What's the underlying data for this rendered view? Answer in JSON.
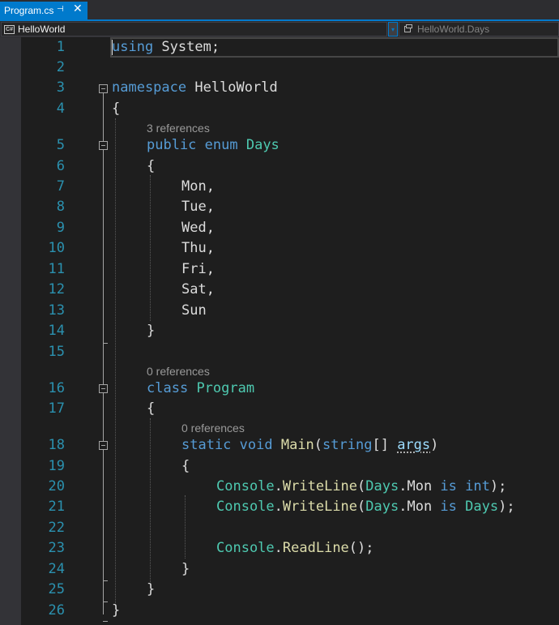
{
  "tab": {
    "title": "Program.cs",
    "pin": "⊣",
    "close": "✕"
  },
  "nav": {
    "project": "HelloWorld",
    "project_icon": "C#",
    "dropdown_glyph": "▾",
    "member": "HelloWorld.Days",
    "member_icon": "member-icon"
  },
  "editor": {
    "line_numbers": [
      "1",
      "2",
      "3",
      "4",
      "5",
      "6",
      "7",
      "8",
      "9",
      "10",
      "11",
      "12",
      "13",
      "14",
      "15",
      "16",
      "17",
      "18",
      "19",
      "20",
      "21",
      "22",
      "23",
      "24",
      "25",
      "26"
    ],
    "lens": [
      "3 references",
      "0 references",
      "0 references"
    ],
    "code": {
      "l1_kw": "using",
      "l1_rest": " System;",
      "l3_kw": "namespace",
      "l3_rest": " HelloWorld",
      "l4": "{",
      "l5_kw": "public enum",
      "l5_ty": "Days",
      "l6": "{",
      "l7": "Mon,",
      "l8": "Tue,",
      "l9": "Wed,",
      "l10": "Thu,",
      "l11": "Fri,",
      "l12": "Sat,",
      "l13": "Sun",
      "l14": "}",
      "l16_kw": "class",
      "l16_ty": "Program",
      "l17": "{",
      "l18_kw": "static void",
      "l18_mt": "Main",
      "l18_open": "(",
      "l18_kw2": "string",
      "l18_arr": "[] ",
      "l18_pm": "args",
      "l18_close": ")",
      "l19": "{",
      "l20_ty": "Console",
      "l20_dot": ".",
      "l20_mt": "WriteLine",
      "l20_open": "(",
      "l20_ty2": "Days",
      "l20_mon": ".Mon ",
      "l20_kw": "is",
      "l20_sp": " ",
      "l20_kw2": "int",
      "l20_end": ");",
      "l21_ty": "Console",
      "l21_dot": ".",
      "l21_mt": "WriteLine",
      "l21_open": "(",
      "l21_ty2": "Days",
      "l21_mon": ".Mon ",
      "l21_kw": "is",
      "l21_sp": " ",
      "l21_ty3": "Days",
      "l21_end": ");",
      "l23_ty": "Console",
      "l23_dot": ".",
      "l23_mt": "ReadLine",
      "l23_end": "();",
      "l24": "}",
      "l25": "}",
      "l26": "}"
    }
  },
  "colors": {
    "keyword": "#569cd6",
    "type": "#4ec9b0",
    "method": "#dcdcaa",
    "enum_member": "#b8d7a3",
    "parameter": "#9cdcfe",
    "line_number": "#2b91af",
    "accent": "#007acc"
  }
}
